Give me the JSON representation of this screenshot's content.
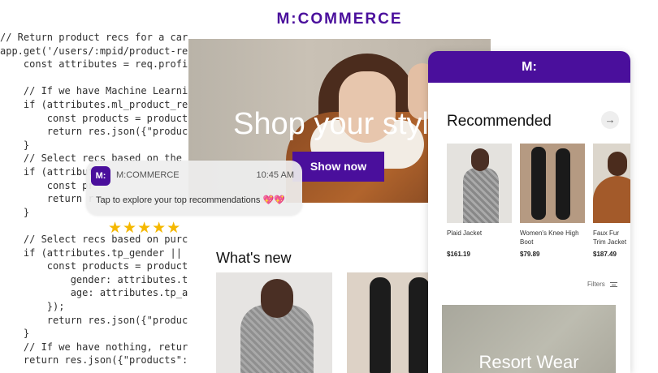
{
  "code": {
    "lines": [
      "// Return product recs for a carou",
      "app.get('/users/:mpid/product-recs",
      "    const attributes = req.profile",
      "",
      "    // If we have Machine Learning",
      "    if (attributes.ml_product_recs",
      "        const products = productRe",
      "        return res.json({\"products",
      "    }",
      "    // Select recs based on the ca",
      "    if (attribut",
      "        const pr",
      "        return r",
      "    }",
      "",
      "    // Select recs based on purcha",
      "    if (attributes.tp_gender || at",
      "        const products = productRe",
      "            gender: attributes.tp_",
      "            age: attributes.tp_age",
      "        });",
      "        return res.json({\"products",
      "    }",
      "    // If we have nothing, return",
      "    return res.json({\"products\": p"
    ]
  },
  "site": {
    "brand": "M:COMMERCE",
    "hero_title": "Shop your style",
    "hero_button": "Show now",
    "section_title": "What's new"
  },
  "notification": {
    "app_icon": "M:",
    "app_name": "M:COMMERCE",
    "time": "10:45 AM",
    "message": "Tap to explore your top recommendations 💖💖"
  },
  "rating": {
    "stars": "★★★★★",
    "value": 5
  },
  "phone": {
    "logo": "M:",
    "rec_title": "Recommended",
    "arrow": "→",
    "products": [
      {
        "name": "Plaid Jacket",
        "price": "$161.19"
      },
      {
        "name": "Women's Knee High Boot",
        "price": "$79.89"
      },
      {
        "name": "Faux Fur Trim Jacket",
        "price": "$187.49"
      }
    ],
    "filters": "Filters",
    "banner_title": "Resort Wear"
  },
  "colors": {
    "brand": "#4a0f9c",
    "star": "#f5b800"
  }
}
